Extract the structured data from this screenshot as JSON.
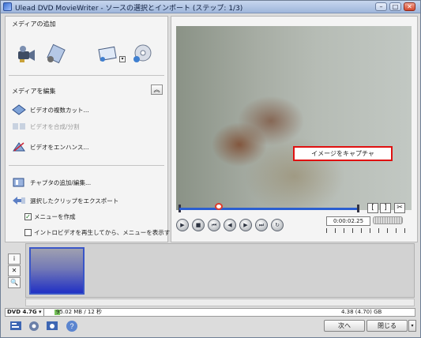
{
  "window": {
    "title": "Ulead DVD MovieWriter - ソースの選択とインポート (ステップ: 1/3)",
    "buttons": {
      "minimize": "–",
      "maximize": "□",
      "close": "✕"
    }
  },
  "left_panel": {
    "add_media_title": "メディアの追加",
    "add_media_icons": [
      "video-camera-icon",
      "import-video-file-icon",
      "import-photo-icon",
      "import-disc-icon"
    ],
    "edit_media_title": "メディアを編集",
    "collapse_symbol": "︽",
    "edit_actions": [
      {
        "label": "ビデオの複数カット...",
        "enabled": true,
        "icon": "multi-trim-icon"
      },
      {
        "label": "ビデオを合成/分割",
        "enabled": false,
        "icon": "merge-split-icon"
      },
      {
        "label": "ビデオをエンハンス...",
        "enabled": true,
        "icon": "enhance-video-icon"
      }
    ],
    "chapter_actions": [
      {
        "label": "チャプタの追加/編集...",
        "icon": "chapter-icon"
      },
      {
        "label": "選択したクリップをエクスポート",
        "icon": "export-clip-icon"
      }
    ],
    "checkboxes": [
      {
        "label": "メニューを作成",
        "checked": true
      },
      {
        "label": "イントロビデオを再生してから、メニューを表示する",
        "checked": false
      }
    ]
  },
  "preview": {
    "capture_button": "イメージをキャプチャ",
    "timecode": "0:00:02.25",
    "bracket_labels": [
      "[",
      "]",
      "✂"
    ],
    "controls": [
      "▶",
      "■",
      "⏮",
      "◀",
      "▶",
      "⏭",
      "↻"
    ],
    "playhead_fraction": 0.22
  },
  "tools": [
    "i",
    "✕",
    "🔍"
  ],
  "status": {
    "disc_type": "DVD 4.7G ▾",
    "used": "95.02 MB / 12 秒",
    "capacity": "4.38 (4.70) GB",
    "used_fraction": 0.02
  },
  "bottom": {
    "next_label": "次へ",
    "close_label": "閉じる",
    "dropdown": "▾"
  }
}
